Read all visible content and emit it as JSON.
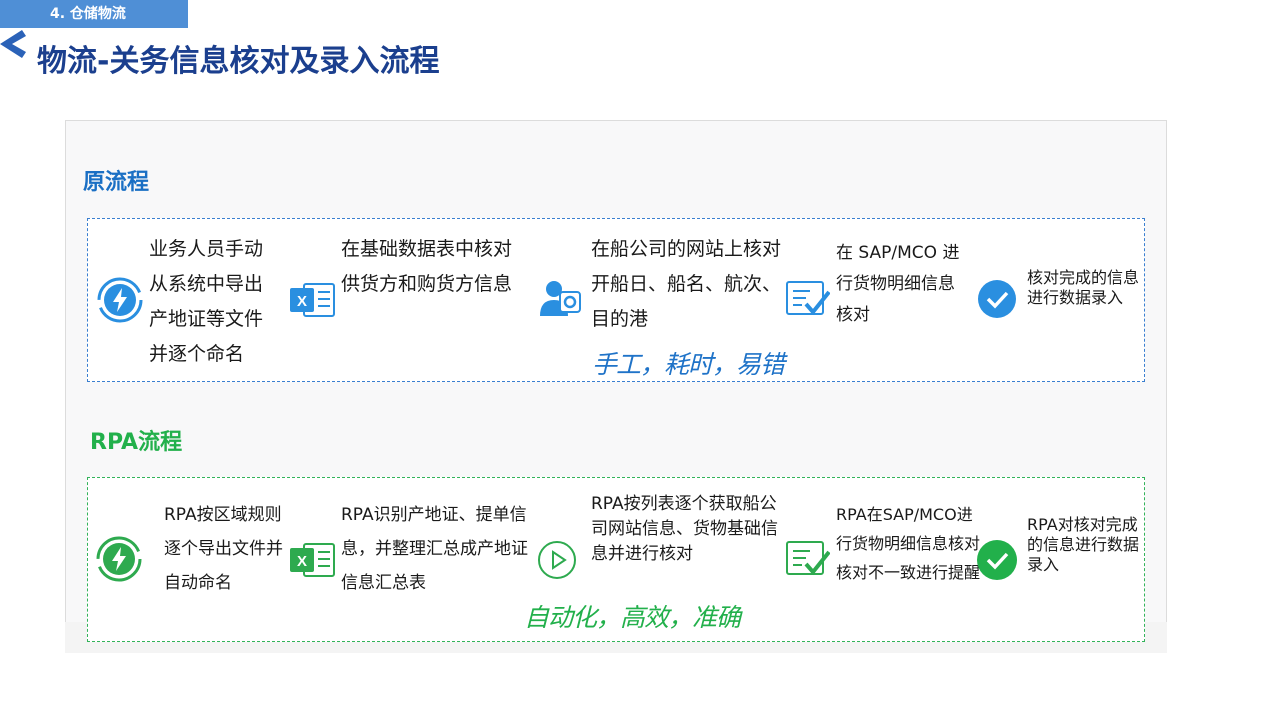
{
  "header": {
    "section_tag": "4. 仓储物流",
    "title": "物流-关务信息核对及录入流程"
  },
  "original_flow": {
    "heading": "原流程",
    "steps": [
      {
        "icon": "refresh-lightning-icon",
        "text": "业务人员手动从系统中导出产地证等文件并逐个命名"
      },
      {
        "icon": "excel-icon",
        "text": "在基础数据表中核对供货方和购货方信息"
      },
      {
        "icon": "user-settings-icon",
        "text": "在船公司的网站上核对开船日、船名、航次、目的港"
      },
      {
        "icon": "checklist-icon",
        "text": "在 SAP/MCO 进行货物明细信息核对"
      },
      {
        "icon": "check-circle-icon",
        "text": "核对完成的信息进行数据录入"
      }
    ],
    "slogan": "手工，耗时，易错"
  },
  "rpa_flow": {
    "heading": "RPA流程",
    "steps": [
      {
        "icon": "refresh-lightning-icon",
        "text": "RPA按区域规则逐个导出文件并自动命名"
      },
      {
        "icon": "excel-icon",
        "text": "RPA识别产地证、提单信息，并整理汇总成产地证信息汇总表"
      },
      {
        "icon": "play-circle-icon",
        "text": "RPA按列表逐个获取船公司网站信息、货物基础信息并进行核对"
      },
      {
        "icon": "checklist-icon",
        "text": "RPA在SAP/MCO进行货物明细信息核对,核对不一致进行提醒"
      },
      {
        "icon": "check-circle-icon",
        "text": "RPA对核对完成的信息进行数据录入"
      }
    ],
    "slogan": "自动化，高效，准确"
  },
  "colors": {
    "title": "#1b3f8e",
    "tag": "#4f8fd6",
    "blue": "#1a6fc4",
    "green": "#22b04b"
  }
}
